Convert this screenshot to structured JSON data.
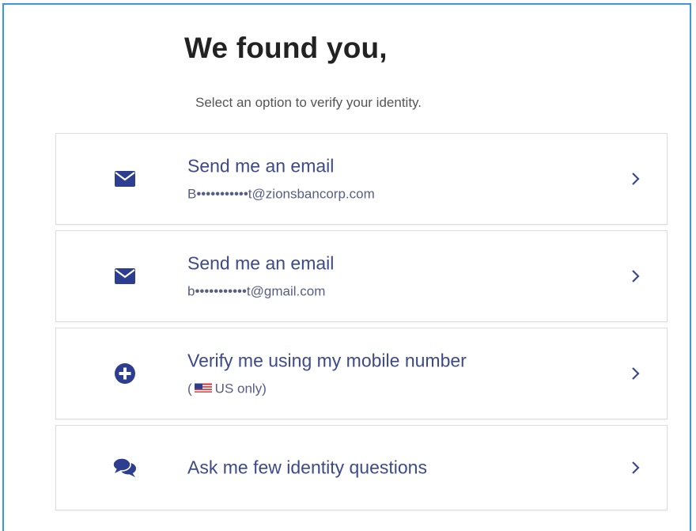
{
  "header": {
    "title": "We found you,",
    "subtitle": "Select an option to verify your identity."
  },
  "options": [
    {
      "title": "Send me an email",
      "subtitle": "B•••••••••••t@zionsbancorp.com",
      "icon": "envelope-icon"
    },
    {
      "title": "Send me an email",
      "subtitle": "b•••••••••••t@gmail.com",
      "icon": "envelope-icon"
    },
    {
      "title": "Verify me using my mobile number",
      "subtitle_prefix": "(",
      "subtitle": "US only)",
      "icon": "plus-circle-icon"
    },
    {
      "title": "Ask me few identity questions",
      "icon": "chat-bubbles-icon"
    }
  ],
  "colors": {
    "accent": "#2d3d8f",
    "frame": "#3a9ad9",
    "option_text": "#3d4a8a"
  }
}
